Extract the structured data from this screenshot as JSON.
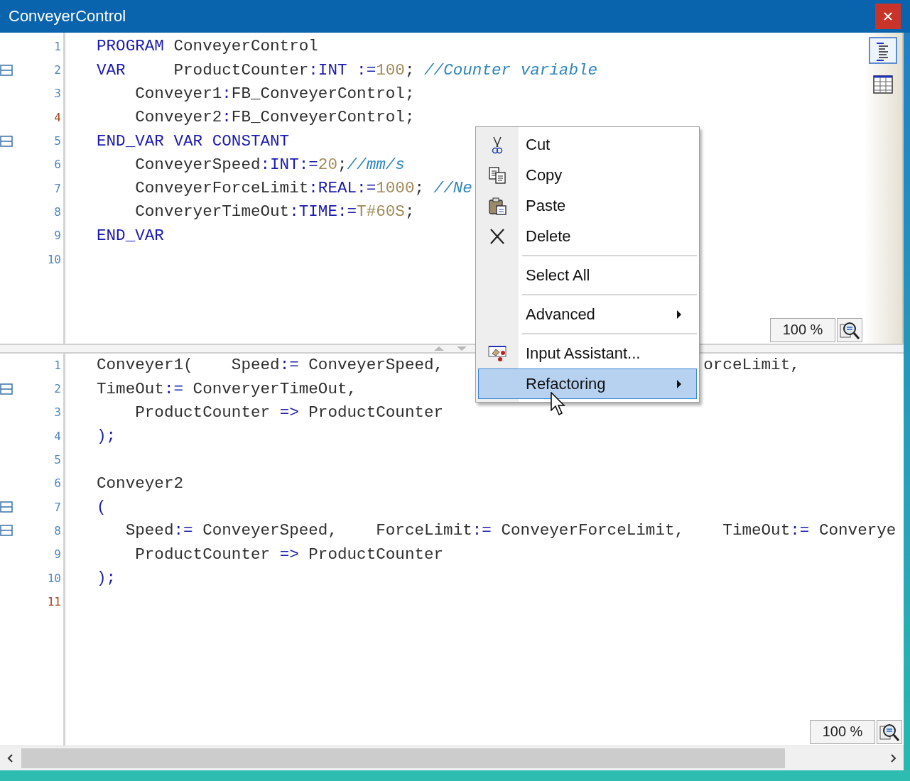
{
  "window": {
    "title": "ConveyerControl"
  },
  "declaration_pane": {
    "lines": [
      {
        "number": "1",
        "marked": false,
        "fold": false,
        "segments": [
          {
            "kind": "keyword",
            "text": "PROGRAM"
          },
          {
            "kind": "plain",
            "text": " ConveyerControl"
          }
        ]
      },
      {
        "number": "2",
        "marked": false,
        "fold": true,
        "segments": [
          {
            "kind": "keyword",
            "text": "VAR"
          },
          {
            "kind": "plain",
            "text": "     ProductCounter"
          },
          {
            "kind": "keyword",
            "text": ":INT :="
          },
          {
            "kind": "number",
            "text": "100"
          },
          {
            "kind": "plain",
            "text": "; "
          },
          {
            "kind": "comment",
            "text": "//Counter variable"
          }
        ]
      },
      {
        "number": "3",
        "marked": false,
        "fold": false,
        "segments": [
          {
            "kind": "plain",
            "text": "    Conveyer1"
          },
          {
            "kind": "keyword",
            "text": ":"
          },
          {
            "kind": "plain",
            "text": "FB_ConveyerControl;"
          }
        ]
      },
      {
        "number": "4",
        "marked": true,
        "fold": false,
        "segments": [
          {
            "kind": "plain",
            "text": "    Conveyer2"
          },
          {
            "kind": "keyword",
            "text": ":"
          },
          {
            "kind": "plain",
            "text": "FB_ConveyerControl;"
          }
        ]
      },
      {
        "number": "5",
        "marked": false,
        "fold": true,
        "segments": [
          {
            "kind": "keyword",
            "text": "END_VAR VAR CONSTANT"
          }
        ]
      },
      {
        "number": "6",
        "marked": false,
        "fold": false,
        "segments": [
          {
            "kind": "plain",
            "text": "    ConveyerSpeed"
          },
          {
            "kind": "keyword",
            "text": ":INT:="
          },
          {
            "kind": "number",
            "text": "20"
          },
          {
            "kind": "plain",
            "text": ";"
          },
          {
            "kind": "comment",
            "text": "//mm/s"
          }
        ]
      },
      {
        "number": "7",
        "marked": false,
        "fold": false,
        "segments": [
          {
            "kind": "plain",
            "text": "    ConveyerForceLimit"
          },
          {
            "kind": "keyword",
            "text": ":REAL:="
          },
          {
            "kind": "number",
            "text": "1000"
          },
          {
            "kind": "plain",
            "text": "; "
          },
          {
            "kind": "comment",
            "text": "//Ne"
          }
        ]
      },
      {
        "number": "8",
        "marked": false,
        "fold": false,
        "segments": [
          {
            "kind": "plain",
            "text": "    ConveryerTimeOut"
          },
          {
            "kind": "keyword",
            "text": ":TIME:="
          },
          {
            "kind": "number",
            "text": "T#60S"
          },
          {
            "kind": "plain",
            "text": ";"
          }
        ]
      },
      {
        "number": "9",
        "marked": false,
        "fold": false,
        "segments": [
          {
            "kind": "keyword",
            "text": "END_VAR"
          }
        ]
      },
      {
        "number": "10",
        "marked": false,
        "fold": false
      }
    ],
    "zoom": "100 %"
  },
  "view_buttons": [
    {
      "selected": true
    },
    {
      "selected": false
    }
  ],
  "implementation_pane": {
    "lines": [
      {
        "number": "1",
        "marked": false,
        "fold": false,
        "segments": [
          {
            "kind": "plain",
            "text": "Conveyer1(    Speed"
          },
          {
            "kind": "keyword",
            "text": ":="
          },
          {
            "kind": "plain",
            "text": " ConveyerSpeed,                           orceLimit,"
          }
        ]
      },
      {
        "number": "2",
        "marked": false,
        "fold": true,
        "segments": [
          {
            "kind": "plain",
            "text": "TimeOut"
          },
          {
            "kind": "keyword",
            "text": ":="
          },
          {
            "kind": "plain",
            "text": " ConveryerTimeOut,"
          }
        ]
      },
      {
        "number": "3",
        "marked": false,
        "fold": false,
        "segments": [
          {
            "kind": "plain",
            "text": "    ProductCounter "
          },
          {
            "kind": "keyword",
            "text": "=>"
          },
          {
            "kind": "plain",
            "text": " ProductCounter"
          }
        ]
      },
      {
        "number": "4",
        "marked": false,
        "fold": false,
        "segments": [
          {
            "kind": "keyword",
            "text": ");"
          }
        ]
      },
      {
        "number": "5",
        "marked": false,
        "fold": false
      },
      {
        "number": "6",
        "marked": false,
        "fold": false,
        "segments": [
          {
            "kind": "plain",
            "text": "Conveyer2"
          }
        ]
      },
      {
        "number": "7",
        "marked": false,
        "fold": true,
        "segments": [
          {
            "kind": "keyword",
            "text": "("
          }
        ]
      },
      {
        "number": "8",
        "marked": false,
        "fold": true,
        "segments": [
          {
            "kind": "plain",
            "text": "   Speed"
          },
          {
            "kind": "keyword",
            "text": ":="
          },
          {
            "kind": "plain",
            "text": " ConveyerSpeed,    ForceLimit"
          },
          {
            "kind": "keyword",
            "text": ":="
          },
          {
            "kind": "plain",
            "text": " ConveyerForceLimit,    TimeOut"
          },
          {
            "kind": "keyword",
            "text": ":="
          },
          {
            "kind": "plain",
            "text": " Converye"
          }
        ]
      },
      {
        "number": "9",
        "marked": false,
        "fold": false,
        "segments": [
          {
            "kind": "plain",
            "text": "    ProductCounter "
          },
          {
            "kind": "keyword",
            "text": "=>"
          },
          {
            "kind": "plain",
            "text": " ProductCounter"
          }
        ]
      },
      {
        "number": "10",
        "marked": false,
        "fold": false,
        "segments": [
          {
            "kind": "keyword",
            "text": ");"
          }
        ]
      },
      {
        "number": "11",
        "marked": true,
        "fold": false
      }
    ],
    "zoom": "100 %"
  },
  "context_menu": {
    "items": [
      {
        "kind": "item",
        "label": "Cut",
        "icon": true,
        "submenu": false,
        "selected": false
      },
      {
        "kind": "item",
        "label": "Copy",
        "icon": true,
        "submenu": false,
        "selected": false
      },
      {
        "kind": "item",
        "label": "Paste",
        "icon": true,
        "submenu": false,
        "selected": false
      },
      {
        "kind": "item",
        "label": "Delete",
        "icon": true,
        "submenu": false,
        "selected": false
      },
      {
        "kind": "separator"
      },
      {
        "kind": "item",
        "label": "Select All",
        "icon": false,
        "submenu": false,
        "selected": false
      },
      {
        "kind": "separator"
      },
      {
        "kind": "item",
        "label": "Advanced",
        "icon": false,
        "submenu": true,
        "selected": false
      },
      {
        "kind": "separator"
      },
      {
        "kind": "item",
        "label": "Input Assistant...",
        "icon": true,
        "submenu": false,
        "selected": false
      },
      {
        "kind": "item",
        "label": "Refactoring",
        "icon": false,
        "submenu": true,
        "selected": true
      }
    ]
  }
}
